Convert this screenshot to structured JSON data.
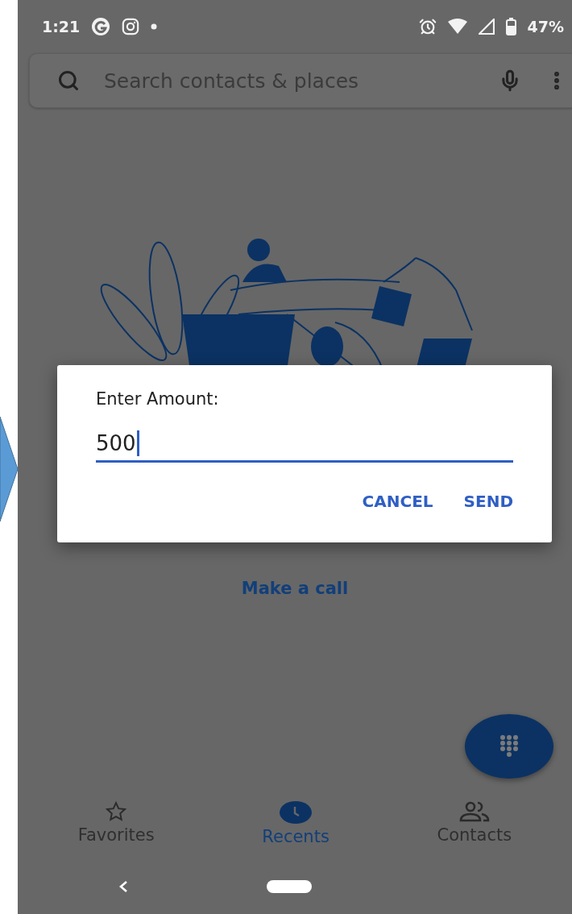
{
  "status_bar": {
    "time": "1:21",
    "battery": "47%"
  },
  "search": {
    "placeholder": "Search contacts & places"
  },
  "empty_state": {
    "link": "Make a call"
  },
  "dialog": {
    "title": "Enter Amount:",
    "value": "500",
    "buttons": [
      "CANCEL",
      "SEND"
    ]
  },
  "bottom_nav": [
    {
      "label": "Favorites",
      "selected": false
    },
    {
      "label": "Recents",
      "selected": true
    },
    {
      "label": "Contacts",
      "selected": false
    }
  ]
}
